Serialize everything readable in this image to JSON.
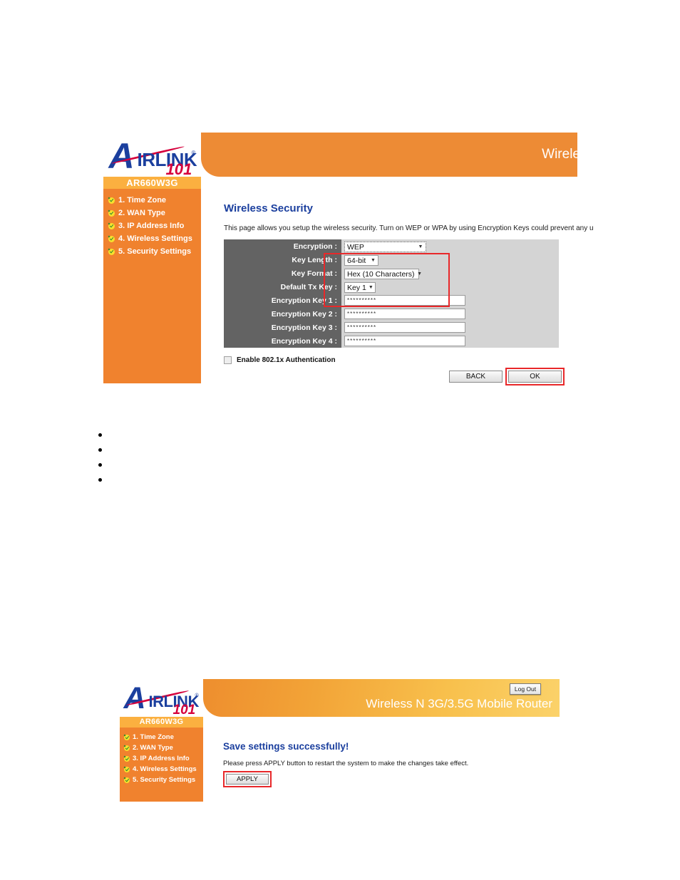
{
  "document": {
    "bullets": [
      "",
      "",
      "",
      ""
    ]
  },
  "screenshot_top": {
    "brand": {
      "letter_a": "A",
      "wordmark": "IRLINK",
      "registered": "®",
      "sub": "101"
    },
    "topbar": {
      "title": "Wirele"
    },
    "sidebar": {
      "model": "AR660W3G",
      "items": [
        {
          "label": "1. Time Zone",
          "icon": "check-icon"
        },
        {
          "label": "2. WAN Type",
          "icon": "check-icon"
        },
        {
          "label": "3. IP Address Info",
          "icon": "check-icon"
        },
        {
          "label": "4. Wireless Settings",
          "icon": "check-icon"
        },
        {
          "label": "5. Security Settings",
          "icon": "check-icon"
        }
      ]
    },
    "content": {
      "title": "Wireless Security",
      "description": "This page allows you setup the wireless security. Turn on WEP or WPA by using Encryption Keys could prevent any u",
      "rows": [
        {
          "label": "Encryption :",
          "type": "select",
          "value": "WEP",
          "width": "wide",
          "focused": true
        },
        {
          "label": "Key Length :",
          "type": "select",
          "value": "64-bit",
          "width": "xs"
        },
        {
          "label": "Key Format :",
          "type": "select",
          "value": "Hex (10 Characters)",
          "width": "md"
        },
        {
          "label": "Default Tx Key :",
          "type": "select",
          "value": "Key 1",
          "width": "sm"
        },
        {
          "label": "Encryption Key 1 :",
          "type": "text",
          "value": "**********"
        },
        {
          "label": "Encryption Key 2 :",
          "type": "text",
          "value": "**********"
        },
        {
          "label": "Encryption Key 3 :",
          "type": "text",
          "value": "**********"
        },
        {
          "label": "Encryption Key 4 :",
          "type": "text",
          "value": "**********"
        }
      ],
      "checkbox": {
        "label": "Enable 802.1x Authentication",
        "checked": false
      },
      "buttons": {
        "back": "BACK",
        "ok": "OK"
      }
    }
  },
  "screenshot_bottom": {
    "brand": {
      "letter_a": "A",
      "wordmark": "IRLINK",
      "registered": "®",
      "sub": "101"
    },
    "topbar": {
      "title": "Wireless N 3G/3.5G Mobile Router",
      "logout": "Log Out"
    },
    "sidebar": {
      "model": "AR660W3G",
      "items": [
        {
          "label": "1. Time Zone",
          "icon": "check-icon"
        },
        {
          "label": "2. WAN Type",
          "icon": "check-icon"
        },
        {
          "label": "3. IP Address Info",
          "icon": "check-icon"
        },
        {
          "label": "4. Wireless Settings",
          "icon": "check-icon"
        },
        {
          "label": "5. Security Settings",
          "icon": "check-icon"
        }
      ]
    },
    "content": {
      "title": "Save settings successfully!",
      "description": "Please press APPLY button to restart the system to make the changes take effect.",
      "apply": "APPLY"
    }
  },
  "colors": {
    "orange_sidebar": "#F0822E",
    "orange_model": "#FBB040",
    "header_orange": "#ED8B35",
    "highlight_red": "#E8282A",
    "title_blue": "#1B3F9E",
    "label_gray": "#636363",
    "value_gray": "#D4D4D4"
  }
}
